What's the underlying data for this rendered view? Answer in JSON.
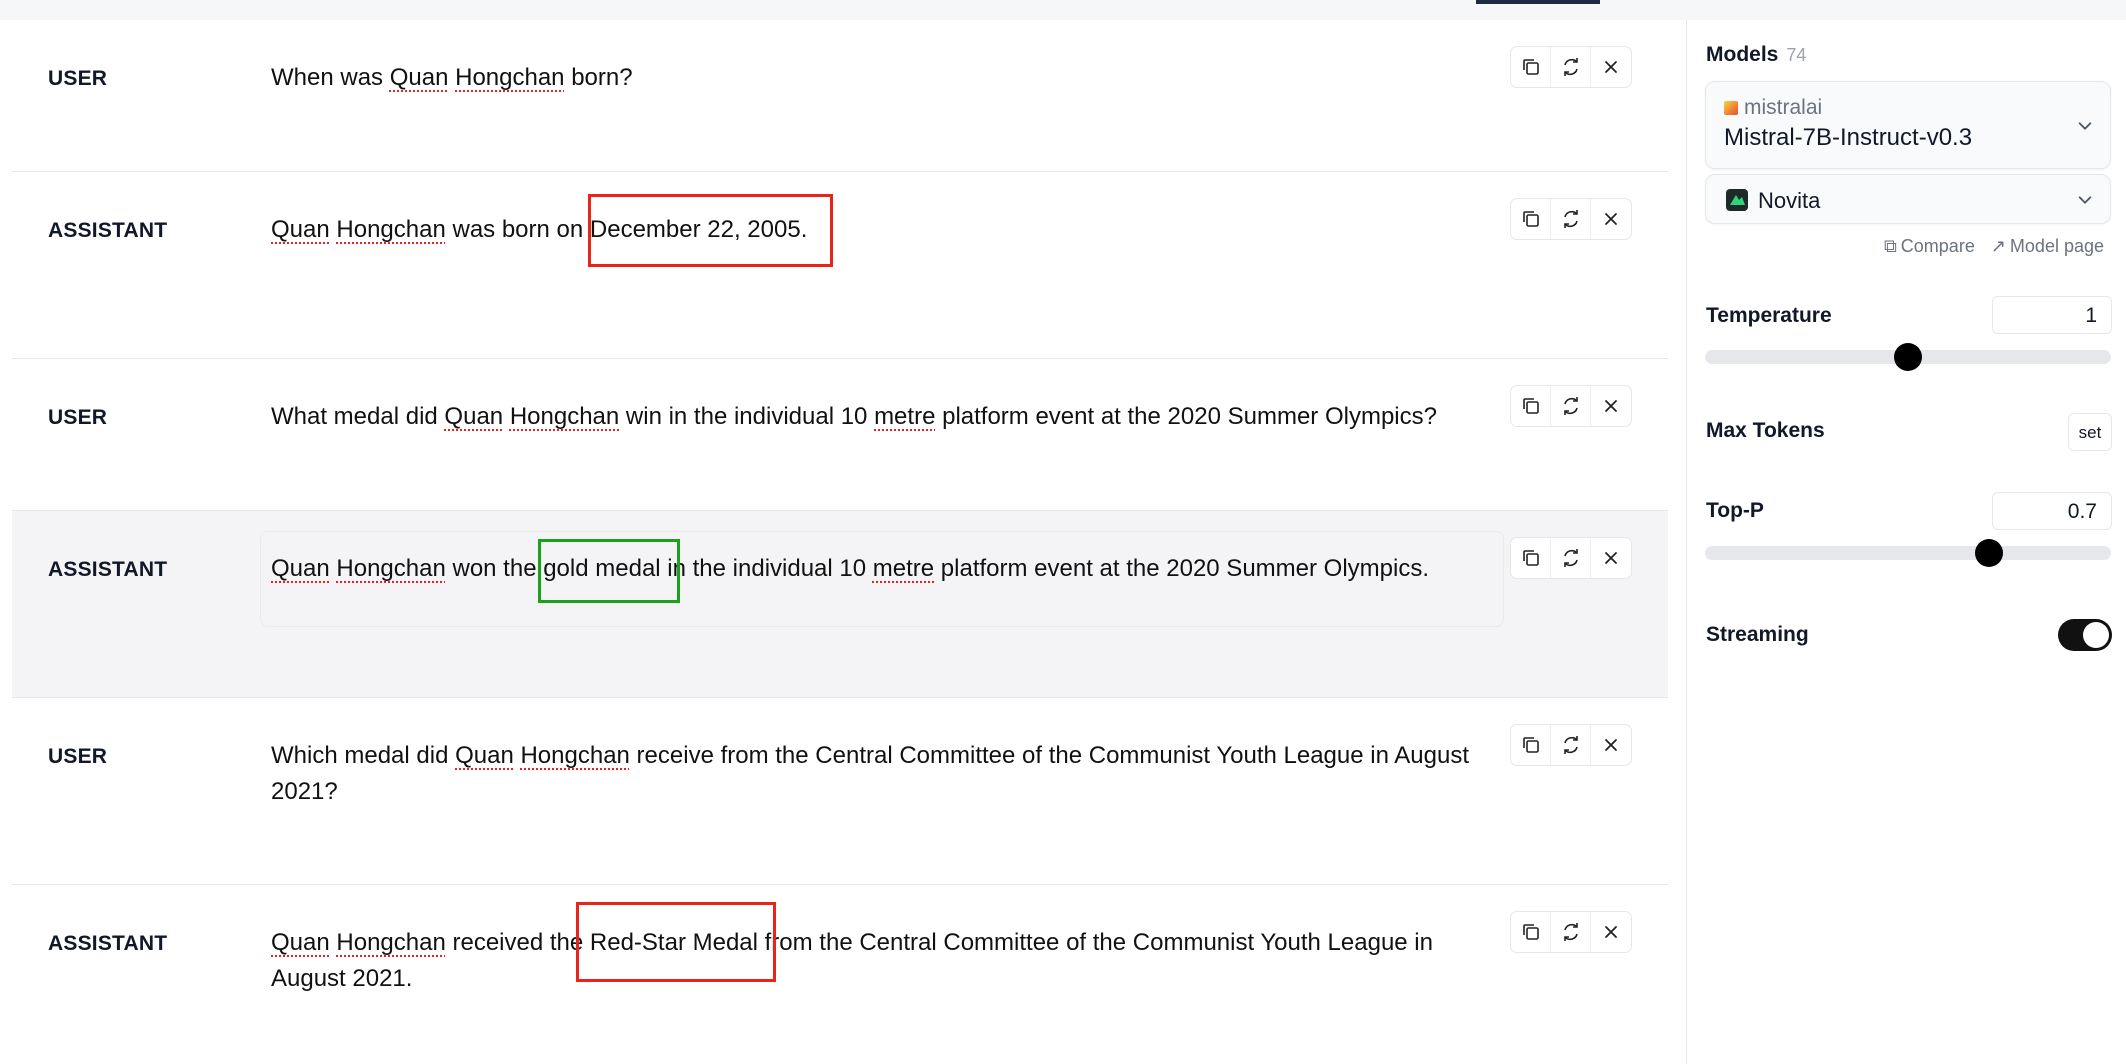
{
  "chat": {
    "messages": [
      {
        "role": "USER",
        "parts": [
          {
            "t": "When was "
          },
          {
            "t": "Quan",
            "sp": true
          },
          {
            "t": " "
          },
          {
            "t": "Hongchan",
            "sp": true
          },
          {
            "t": " born?"
          }
        ]
      },
      {
        "role": "ASSISTANT",
        "parts": [
          {
            "t": "Quan",
            "sp": true
          },
          {
            "t": " "
          },
          {
            "t": "Hongchan",
            "sp": true
          },
          {
            "t": " was born on December 22, 2005."
          }
        ]
      },
      {
        "role": "USER",
        "parts": [
          {
            "t": "What medal did "
          },
          {
            "t": "Quan",
            "sp": true
          },
          {
            "t": " "
          },
          {
            "t": "Hongchan",
            "sp": true
          },
          {
            "t": " win in the individual 10 "
          },
          {
            "t": "metre",
            "sp": true
          },
          {
            "t": " platform event at the 2020 Summer Olympics?"
          }
        ]
      },
      {
        "role": "ASSISTANT",
        "parts": [
          {
            "t": "Quan",
            "sp": true
          },
          {
            "t": " "
          },
          {
            "t": "Hongchan",
            "sp": true
          },
          {
            "t": " won the gold medal in the individual 10 "
          },
          {
            "t": "metre",
            "sp": true
          },
          {
            "t": " platform event at the 2020 Summer Olympics."
          }
        ]
      },
      {
        "role": "USER",
        "parts": [
          {
            "t": "Which medal did "
          },
          {
            "t": "Quan",
            "sp": true
          },
          {
            "t": " "
          },
          {
            "t": "Hongchan",
            "sp": true
          },
          {
            "t": " receive from the Central Committee of the Communist Youth League in August 2021?"
          }
        ]
      },
      {
        "role": "ASSISTANT",
        "parts": [
          {
            "t": "Quan",
            "sp": true
          },
          {
            "t": " "
          },
          {
            "t": "Hongchan",
            "sp": true
          },
          {
            "t": " received the Red-Star Medal from the Central Committee of the Communist Youth League in August 2021."
          }
        ]
      }
    ],
    "action_icons": [
      "copy-icon",
      "regenerate-icon",
      "close-icon"
    ]
  },
  "sidebar": {
    "models_label": "Models",
    "models_count": "74",
    "model_provider": "mistralai",
    "model_name": "Mistral-7B-Instruct-v0.3",
    "inference_provider": "Novita",
    "compare_label": "Compare",
    "model_page_label": "Model page",
    "temperature_label": "Temperature",
    "temperature_value": "1",
    "temperature_level": 0.5,
    "max_tokens_label": "Max Tokens",
    "max_tokens_button": "set",
    "top_p_label": "Top-P",
    "top_p_value": "0.7",
    "top_p_level": 0.7,
    "streaming_label": "Streaming",
    "streaming_on": true
  },
  "colors": {
    "annotation_red": "#e8241b",
    "annotation_green": "#1aa31a",
    "highlight_row": "#f4f4f6"
  }
}
